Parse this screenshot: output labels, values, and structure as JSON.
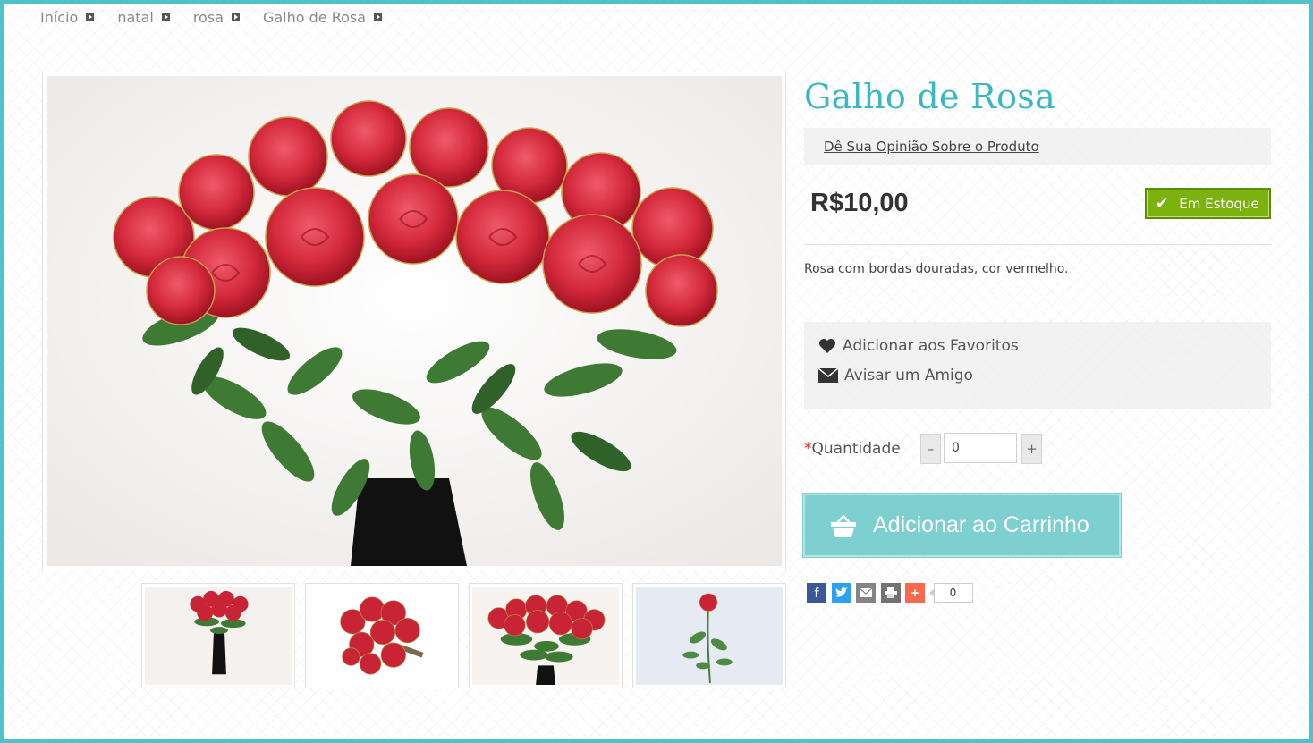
{
  "breadcrumb": [
    {
      "label": "Início"
    },
    {
      "label": "natal"
    },
    {
      "label": "rosa"
    },
    {
      "label": "Galho de Rosa"
    }
  ],
  "product": {
    "title": "Galho de Rosa",
    "review_link": "Dê Sua Opinião Sobre o Produto",
    "price": "R$10,00",
    "stock_label": "Em Estoque",
    "description": "Rosa com bordas douradas, cor vermelho."
  },
  "actions": {
    "favorites": "Adicionar aos Favoritos",
    "tell_friend": "Avisar um Amigo"
  },
  "quantity": {
    "label": "Quantidade",
    "required_mark": "*",
    "value": "0",
    "minus": "–",
    "plus": "+"
  },
  "cart": {
    "button_label": "Adicionar ao Carrinho"
  },
  "share": {
    "icons": [
      "facebook-icon",
      "twitter-icon",
      "email-icon",
      "print-icon",
      "addthis-icon"
    ],
    "count": "0"
  },
  "colors": {
    "accent": "#3bb8bf",
    "frame": "#4fc3c9",
    "stock": "#7cb20f",
    "cart": "#7ecfcf"
  }
}
